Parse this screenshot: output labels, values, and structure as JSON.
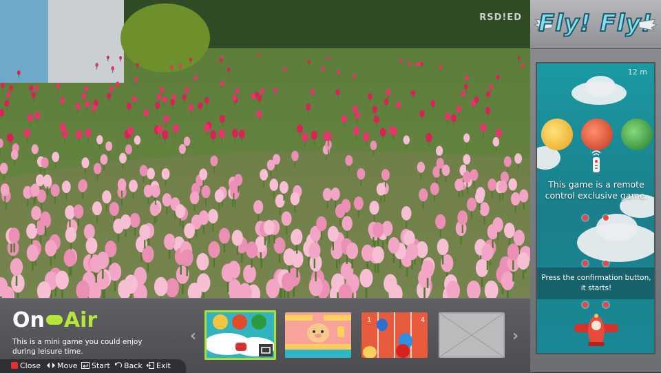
{
  "channel_logo": "RSD!ED",
  "panel": {
    "game_title": "Fly! Fly!",
    "distance": "12 m",
    "message_remote": "This game is a remote control exclusive game.",
    "message_start": "Press the confirmation button, it starts!"
  },
  "bar": {
    "brand_on": "On",
    "brand_air": "Air",
    "description": "This is a mini game you could enjoy during leisure time.",
    "hints": [
      {
        "label": "Close",
        "icon": "red-square-icon"
      },
      {
        "label": "Move",
        "icon": "left-right-arrows-icon"
      },
      {
        "label": "Start",
        "icon": "enter-icon"
      },
      {
        "label": "Back",
        "icon": "back-icon"
      },
      {
        "label": "Exit",
        "icon": "exit-icon"
      }
    ],
    "thumbnails": [
      {
        "name": "fly-fly",
        "selected": true
      },
      {
        "name": "pig-runner",
        "selected": false
      },
      {
        "name": "bird-race",
        "selected": false
      },
      {
        "name": "empty",
        "selected": false
      }
    ]
  },
  "colors": {
    "accent_green": "#b7e63a",
    "panel_screen": "#1a8f9a",
    "hint_close": "#e03030"
  }
}
